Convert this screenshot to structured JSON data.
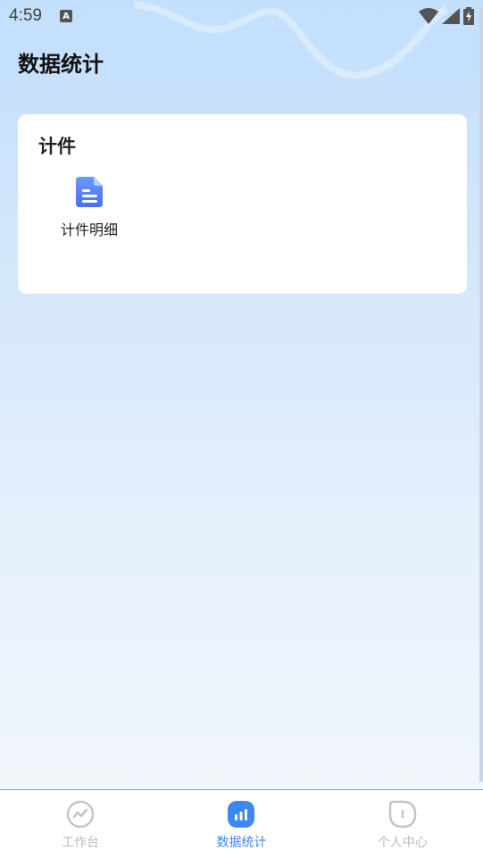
{
  "status_bar": {
    "time": "4:59",
    "indicator_letter": "A",
    "icons": [
      "wifi-icon",
      "signal-icon",
      "battery-charging-icon"
    ]
  },
  "page": {
    "title": "数据统计"
  },
  "card": {
    "title": "计件",
    "items": [
      {
        "label": "计件明细",
        "icon": "document-icon"
      }
    ]
  },
  "bottom_nav": {
    "active_index": 1,
    "items": [
      {
        "label": "工作台",
        "icon": "trend-icon"
      },
      {
        "label": "数据统计",
        "icon": "bar-chart-icon"
      },
      {
        "label": "个人中心",
        "icon": "person-icon"
      }
    ]
  },
  "colors": {
    "accent": "#3d87f2",
    "inactive": "#bbbbbb",
    "bg_top": "#c2dffc",
    "bg_bottom": "#f4f7fb"
  }
}
